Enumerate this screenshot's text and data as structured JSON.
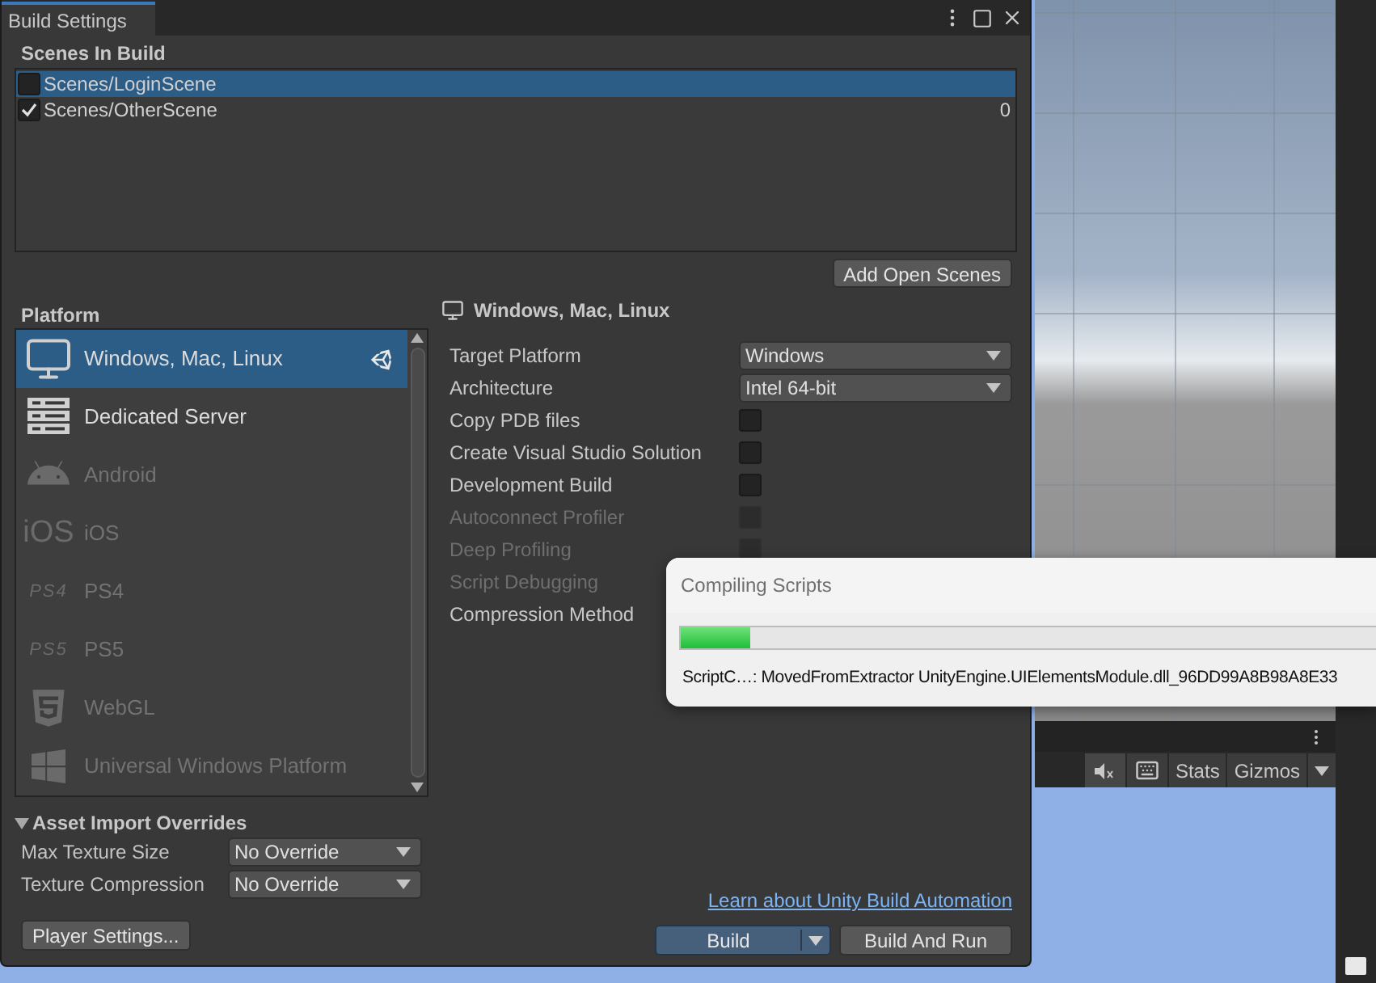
{
  "window": {
    "title": "Build Settings"
  },
  "scenes": {
    "title": "Scenes In Build",
    "items": [
      {
        "name": "Scenes/LoginScene",
        "checked": false,
        "selected": true
      },
      {
        "name": "Scenes/OtherScene",
        "checked": true,
        "selected": false,
        "index": "0"
      }
    ],
    "add_button": "Add Open Scenes"
  },
  "platform": {
    "title": "Platform",
    "items": [
      {
        "name": "Windows, Mac, Linux",
        "selected": true,
        "active": true,
        "disabled": false
      },
      {
        "name": "Dedicated Server",
        "selected": false,
        "active": false,
        "disabled": false
      },
      {
        "name": "Android",
        "selected": false,
        "active": false,
        "disabled": true
      },
      {
        "name": "iOS",
        "icon_text": "iOS",
        "selected": false,
        "active": false,
        "disabled": true
      },
      {
        "name": "PS4",
        "icon_text": "PS4",
        "selected": false,
        "active": false,
        "disabled": true
      },
      {
        "name": "PS5",
        "icon_text": "PS5",
        "selected": false,
        "active": false,
        "disabled": true
      },
      {
        "name": "WebGL",
        "selected": false,
        "active": false,
        "disabled": true
      },
      {
        "name": "Universal Windows Platform",
        "selected": false,
        "active": false,
        "disabled": true
      }
    ]
  },
  "settings": {
    "title": "Windows, Mac, Linux",
    "rows": [
      {
        "kind": "dropdown",
        "label": "Target Platform",
        "value": "Windows",
        "disabled": false
      },
      {
        "kind": "dropdown",
        "label": "Architecture",
        "value": "Intel 64-bit",
        "disabled": false
      },
      {
        "kind": "checkbox",
        "label": "Copy PDB files",
        "checked": false,
        "disabled": false
      },
      {
        "kind": "checkbox",
        "label": "Create Visual Studio Solution",
        "checked": false,
        "disabled": false
      },
      {
        "kind": "checkbox",
        "label": "Development Build",
        "checked": false,
        "disabled": false
      },
      {
        "kind": "checkbox",
        "label": "Autoconnect Profiler",
        "checked": false,
        "disabled": true
      },
      {
        "kind": "checkbox",
        "label": "Deep Profiling",
        "checked": false,
        "disabled": true
      },
      {
        "kind": "checkbox",
        "label": "Script Debugging",
        "disabled": true
      },
      {
        "kind": "dropdown",
        "label": "Compression Method",
        "disabled": false
      }
    ]
  },
  "asset_import_overrides": {
    "title": "Asset Import Overrides",
    "expanded": true,
    "rows": [
      {
        "label": "Max Texture Size",
        "value": "No Override"
      },
      {
        "label": "Texture Compression",
        "value": "No Override"
      }
    ]
  },
  "link": "Learn about Unity Build Automation",
  "buttons": {
    "player_settings": "Player Settings...",
    "build": "Build",
    "build_and_run": "Build And Run"
  },
  "progress_dialog": {
    "title": "Compiling Scripts",
    "level": 0.1,
    "message": "ScriptC…: MovedFromExtractor UnityEngine.UIElementsModule.dll_96DD99A8B98A8E33"
  },
  "scene_toolbar": {
    "buttons": [
      "Stats",
      "Gizmos"
    ]
  }
}
